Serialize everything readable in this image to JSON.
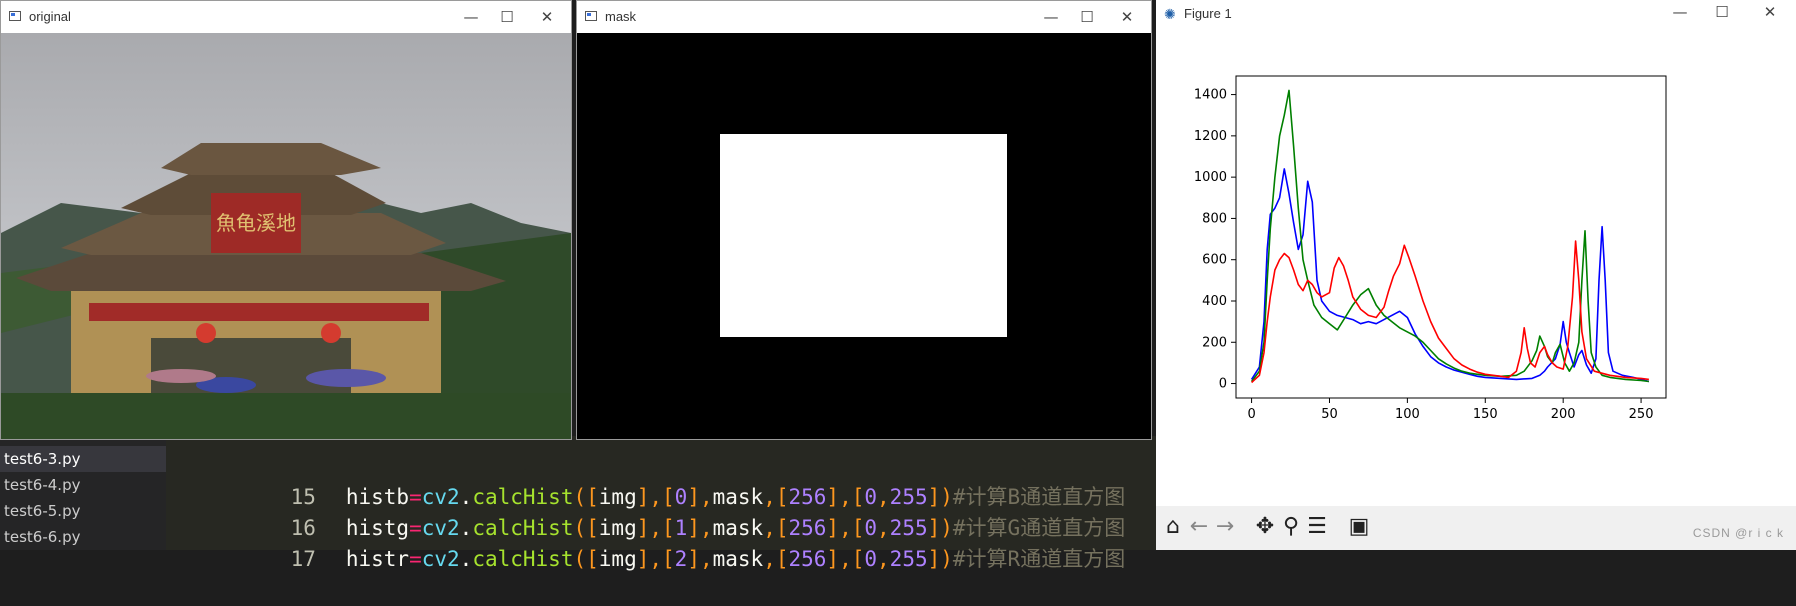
{
  "windows": {
    "original": {
      "title": "original"
    },
    "mask": {
      "title": "mask"
    },
    "figure": {
      "title": "Figure 1"
    }
  },
  "controls": {
    "minimize": "—",
    "maximize": "☐",
    "close": "✕"
  },
  "photo": {
    "sign_text": "魚龟溪地"
  },
  "editor": {
    "files": [
      "test6-3.py",
      "test6-4.py",
      "test6-5.py",
      "test6-6.py"
    ],
    "active_file": "test6-3.py",
    "lines": [
      {
        "num": "15",
        "var": "histb",
        "channel": "0",
        "comment": "#计算B通道直方图"
      },
      {
        "num": "16",
        "var": "histg",
        "channel": "1",
        "comment": "#计算G通道直方图"
      },
      {
        "num": "17",
        "var": "histr",
        "channel": "2",
        "comment": "#计算R通道直方图"
      }
    ],
    "tokens": {
      "eq": "=",
      "mod": "cv2",
      "dot": ".",
      "fn": "calcHist",
      "img": "img",
      "mask": "mask",
      "bins": "256",
      "range_lo": "0",
      "range_hi": "255"
    }
  },
  "toolbar": {
    "icons": [
      "home-icon",
      "back-icon",
      "forward-icon",
      "pan-icon",
      "zoom-icon",
      "configure-icon",
      "save-icon"
    ],
    "watermark": "CSDN @r i c k"
  },
  "chart_data": {
    "type": "line",
    "title": "",
    "xlabel": "",
    "ylabel": "",
    "xlim": [
      -10,
      266
    ],
    "ylim": [
      -70,
      1490
    ],
    "xticks": [
      0,
      50,
      100,
      150,
      200,
      250
    ],
    "yticks": [
      0,
      200,
      400,
      600,
      800,
      1000,
      1200,
      1400
    ],
    "grid": false,
    "series": [
      {
        "color": "#0000ff",
        "points": [
          [
            0,
            20
          ],
          [
            5,
            80
          ],
          [
            8,
            300
          ],
          [
            10,
            650
          ],
          [
            12,
            820
          ],
          [
            15,
            850
          ],
          [
            18,
            900
          ],
          [
            21,
            1040
          ],
          [
            24,
            920
          ],
          [
            27,
            780
          ],
          [
            30,
            650
          ],
          [
            33,
            720
          ],
          [
            36,
            980
          ],
          [
            39,
            880
          ],
          [
            42,
            500
          ],
          [
            45,
            400
          ],
          [
            50,
            350
          ],
          [
            55,
            330
          ],
          [
            60,
            320
          ],
          [
            65,
            310
          ],
          [
            70,
            290
          ],
          [
            75,
            300
          ],
          [
            80,
            290
          ],
          [
            85,
            310
          ],
          [
            90,
            330
          ],
          [
            95,
            350
          ],
          [
            100,
            320
          ],
          [
            105,
            240
          ],
          [
            110,
            180
          ],
          [
            115,
            130
          ],
          [
            120,
            100
          ],
          [
            125,
            80
          ],
          [
            130,
            65
          ],
          [
            135,
            55
          ],
          [
            140,
            45
          ],
          [
            145,
            35
          ],
          [
            150,
            30
          ],
          [
            160,
            25
          ],
          [
            170,
            20
          ],
          [
            180,
            25
          ],
          [
            185,
            40
          ],
          [
            188,
            60
          ],
          [
            190,
            80
          ],
          [
            195,
            120
          ],
          [
            198,
            190
          ],
          [
            200,
            300
          ],
          [
            202,
            200
          ],
          [
            204,
            150
          ],
          [
            207,
            80
          ],
          [
            210,
            140
          ],
          [
            212,
            160
          ],
          [
            215,
            90
          ],
          [
            218,
            50
          ],
          [
            221,
            120
          ],
          [
            223,
            500
          ],
          [
            225,
            760
          ],
          [
            227,
            500
          ],
          [
            229,
            150
          ],
          [
            232,
            60
          ],
          [
            238,
            40
          ],
          [
            245,
            30
          ],
          [
            250,
            20
          ],
          [
            255,
            10
          ]
        ]
      },
      {
        "color": "#008000",
        "points": [
          [
            0,
            10
          ],
          [
            5,
            60
          ],
          [
            8,
            200
          ],
          [
            10,
            500
          ],
          [
            12,
            750
          ],
          [
            15,
            1000
          ],
          [
            18,
            1200
          ],
          [
            21,
            1300
          ],
          [
            24,
            1420
          ],
          [
            27,
            1150
          ],
          [
            30,
            850
          ],
          [
            33,
            600
          ],
          [
            36,
            500
          ],
          [
            40,
            380
          ],
          [
            45,
            320
          ],
          [
            50,
            290
          ],
          [
            55,
            260
          ],
          [
            60,
            320
          ],
          [
            65,
            380
          ],
          [
            70,
            430
          ],
          [
            75,
            460
          ],
          [
            80,
            380
          ],
          [
            85,
            330
          ],
          [
            90,
            300
          ],
          [
            95,
            270
          ],
          [
            100,
            250
          ],
          [
            105,
            230
          ],
          [
            110,
            200
          ],
          [
            115,
            160
          ],
          [
            120,
            120
          ],
          [
            125,
            95
          ],
          [
            130,
            75
          ],
          [
            135,
            60
          ],
          [
            140,
            50
          ],
          [
            145,
            45
          ],
          [
            150,
            40
          ],
          [
            160,
            35
          ],
          [
            170,
            40
          ],
          [
            175,
            60
          ],
          [
            180,
            110
          ],
          [
            183,
            160
          ],
          [
            185,
            230
          ],
          [
            188,
            180
          ],
          [
            190,
            130
          ],
          [
            193,
            100
          ],
          [
            195,
            150
          ],
          [
            198,
            190
          ],
          [
            201,
            100
          ],
          [
            204,
            60
          ],
          [
            207,
            100
          ],
          [
            210,
            200
          ],
          [
            212,
            500
          ],
          [
            214,
            740
          ],
          [
            216,
            400
          ],
          [
            218,
            150
          ],
          [
            221,
            80
          ],
          [
            225,
            40
          ],
          [
            230,
            30
          ],
          [
            240,
            20
          ],
          [
            250,
            15
          ],
          [
            255,
            10
          ]
        ]
      },
      {
        "color": "#ff0000",
        "points": [
          [
            0,
            5
          ],
          [
            5,
            40
          ],
          [
            8,
            150
          ],
          [
            10,
            300
          ],
          [
            12,
            420
          ],
          [
            15,
            550
          ],
          [
            18,
            600
          ],
          [
            21,
            630
          ],
          [
            24,
            610
          ],
          [
            27,
            550
          ],
          [
            30,
            480
          ],
          [
            33,
            450
          ],
          [
            36,
            500
          ],
          [
            39,
            480
          ],
          [
            42,
            440
          ],
          [
            45,
            420
          ],
          [
            50,
            440
          ],
          [
            53,
            560
          ],
          [
            56,
            610
          ],
          [
            59,
            570
          ],
          [
            62,
            500
          ],
          [
            65,
            420
          ],
          [
            70,
            360
          ],
          [
            75,
            330
          ],
          [
            80,
            320
          ],
          [
            85,
            370
          ],
          [
            88,
            450
          ],
          [
            91,
            520
          ],
          [
            95,
            580
          ],
          [
            98,
            670
          ],
          [
            101,
            610
          ],
          [
            105,
            520
          ],
          [
            110,
            400
          ],
          [
            115,
            300
          ],
          [
            120,
            220
          ],
          [
            125,
            170
          ],
          [
            130,
            120
          ],
          [
            135,
            90
          ],
          [
            140,
            70
          ],
          [
            145,
            55
          ],
          [
            150,
            45
          ],
          [
            155,
            40
          ],
          [
            160,
            35
          ],
          [
            165,
            30
          ],
          [
            170,
            60
          ],
          [
            173,
            150
          ],
          [
            175,
            270
          ],
          [
            177,
            170
          ],
          [
            179,
            100
          ],
          [
            182,
            80
          ],
          [
            185,
            150
          ],
          [
            188,
            180
          ],
          [
            190,
            140
          ],
          [
            193,
            100
          ],
          [
            196,
            80
          ],
          [
            200,
            70
          ],
          [
            203,
            180
          ],
          [
            206,
            420
          ],
          [
            208,
            690
          ],
          [
            210,
            500
          ],
          [
            212,
            250
          ],
          [
            215,
            120
          ],
          [
            220,
            60
          ],
          [
            230,
            40
          ],
          [
            240,
            30
          ],
          [
            250,
            25
          ],
          [
            255,
            20
          ]
        ]
      }
    ]
  }
}
